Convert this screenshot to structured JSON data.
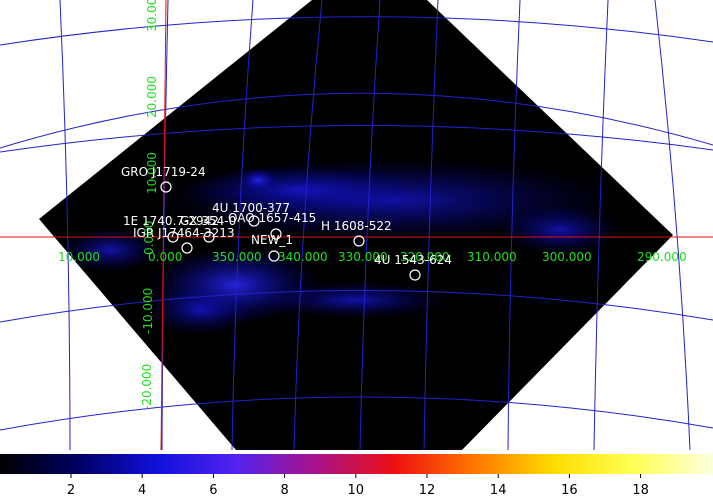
{
  "grid": {
    "line_color": "#2222cc",
    "label_color": "#22dd22",
    "longitude_labels": [
      "10.000",
      "0.000",
      "350.000",
      "340.000",
      "330.000",
      "320.000",
      "310.000",
      "300.000",
      "290.000"
    ],
    "latitude_labels": [
      "30.000",
      "20.000",
      "10.000",
      "0.000",
      "-10.000",
      "-20.000"
    ],
    "equator_color": "#dd1111"
  },
  "sources": [
    {
      "name": "GRO J1719-24"
    },
    {
      "name": "4U 1700-377"
    },
    {
      "name": "1E 1740.7-2942"
    },
    {
      "name": "GX 354-0"
    },
    {
      "name": "OAO 1657-415"
    },
    {
      "name": "H 1608-522"
    },
    {
      "name": "IGR J17464-3213"
    },
    {
      "name": "NEW_1"
    },
    {
      "name": "4U 1543-624"
    }
  ],
  "colorbar": {
    "ticks": [
      "2",
      "4",
      "6",
      "8",
      "10",
      "12",
      "14",
      "16",
      "18"
    ],
    "gradient": [
      "#000000",
      "#000066",
      "#1111dd",
      "#5522ee",
      "#aa1188",
      "#ee1111",
      "#ff7700",
      "#ffdd00",
      "#ffff55",
      "#ffffdd"
    ]
  }
}
